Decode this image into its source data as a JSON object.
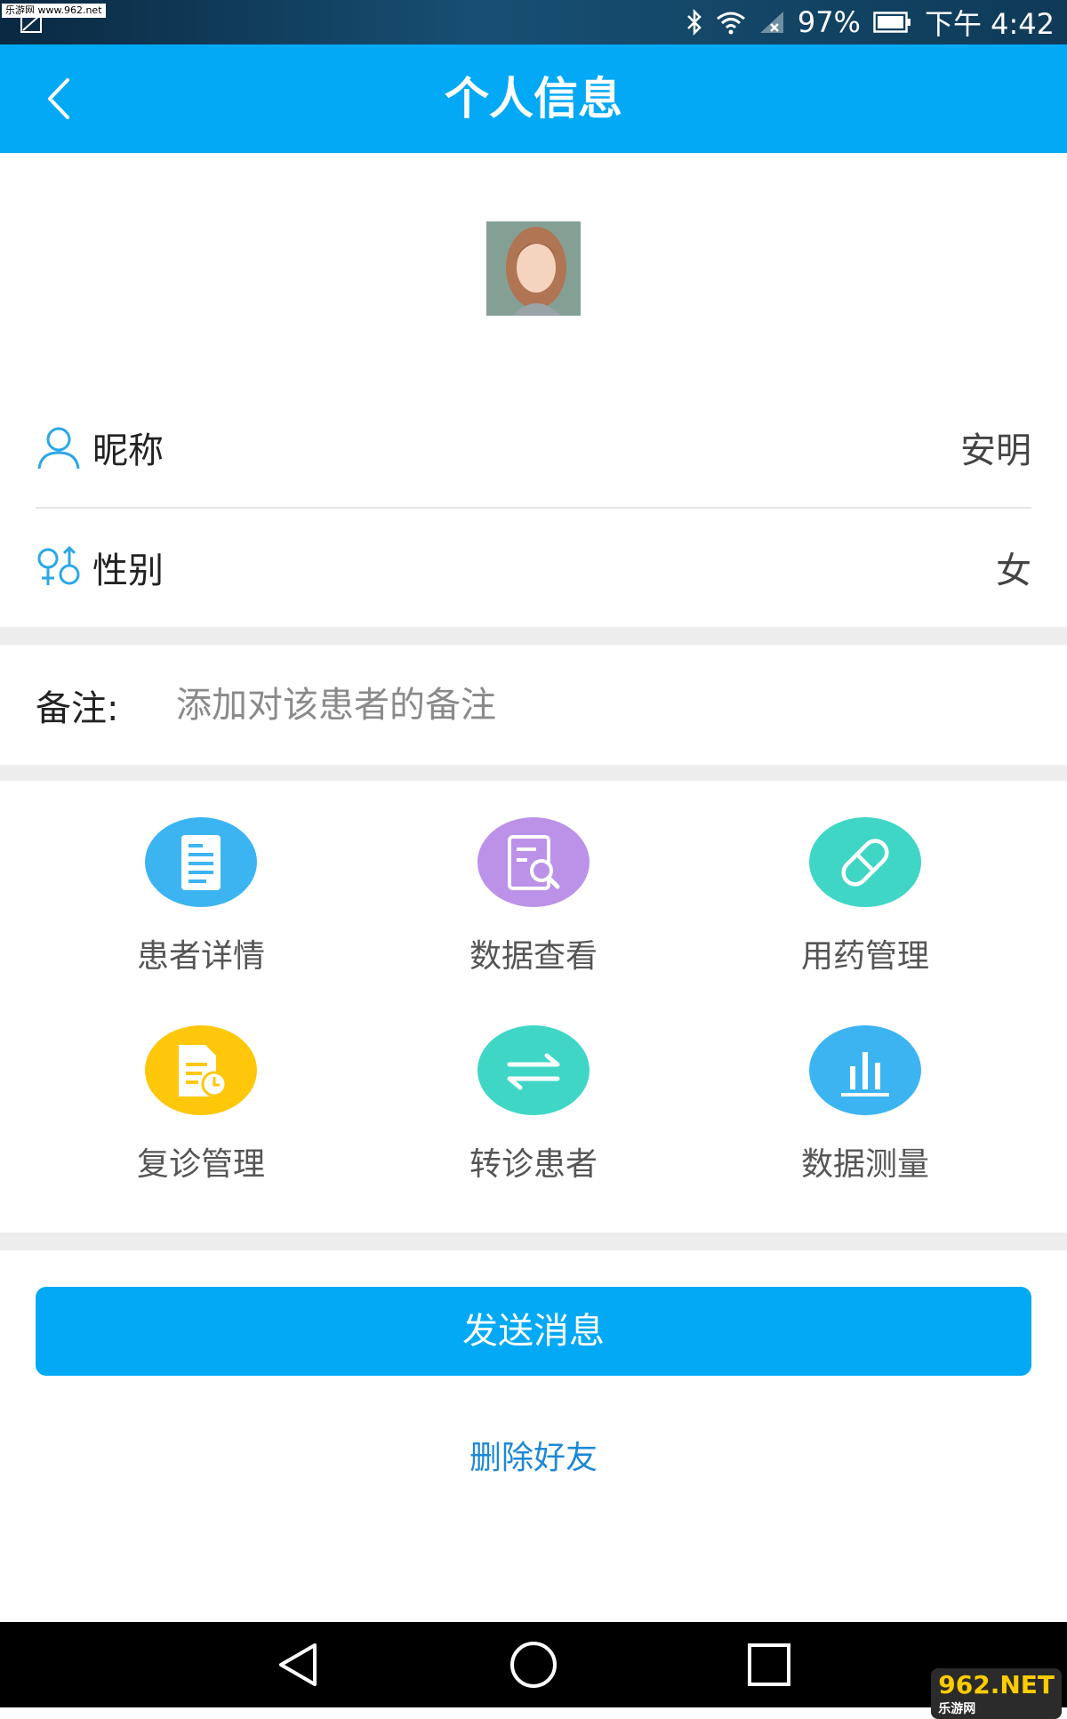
{
  "status_bar": {
    "watermark": "乐游网 www.962.net",
    "battery": "97%",
    "time": "下午 4:42"
  },
  "header": {
    "title": "个人信息"
  },
  "profile": {
    "nickname_label": "昵称",
    "nickname_value": "安明",
    "gender_label": "性别",
    "gender_value": "女"
  },
  "remark": {
    "label": "备注:",
    "value": "",
    "placeholder": "添加对该患者的备注"
  },
  "functions": [
    {
      "label": "患者详情",
      "icon": "document-icon",
      "color": "#3db4f2"
    },
    {
      "label": "数据查看",
      "icon": "search-document-icon",
      "color": "#bb92e8"
    },
    {
      "label": "用药管理",
      "icon": "pill-icon",
      "color": "#3fd6c6"
    },
    {
      "label": "复诊管理",
      "icon": "document-clock-icon",
      "color": "#ffc70a"
    },
    {
      "label": "转诊患者",
      "icon": "transfer-arrows-icon",
      "color": "#3fd6c6"
    },
    {
      "label": "数据测量",
      "icon": "bar-chart-icon",
      "color": "#3db4f2"
    }
  ],
  "actions": {
    "send_label": "发送消息",
    "delete_label": "删除好友"
  },
  "nav_bar": {
    "logo": "962.NET",
    "logo_sub": "乐游网"
  },
  "colors": {
    "primary": "#03a9f4",
    "link": "#1e88d6",
    "separator": "#ededed"
  }
}
